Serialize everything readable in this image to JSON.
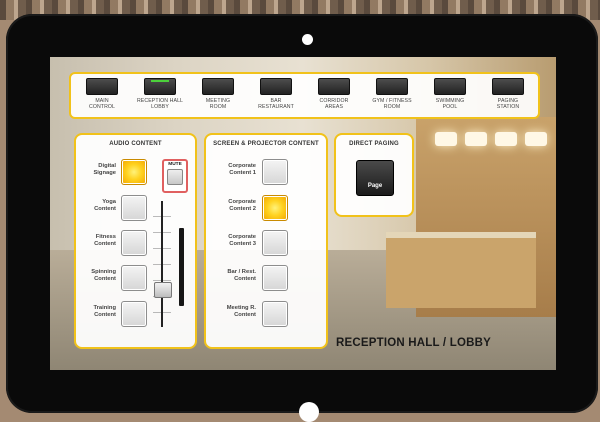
{
  "nav": {
    "items": [
      {
        "label_1": "MAIN",
        "label_2": "CONTROL"
      },
      {
        "label_1": "RECEPTION HALL",
        "label_2": "LOBBY",
        "active": true
      },
      {
        "label_1": "MEETING",
        "label_2": "ROOM"
      },
      {
        "label_1": "BAR",
        "label_2": "RESTAURANT"
      },
      {
        "label_1": "CORRIDOR",
        "label_2": "AREAS"
      },
      {
        "label_1": "GYM / FITNESS",
        "label_2": "ROOM"
      },
      {
        "label_1": "SWIMMING",
        "label_2": "POOL"
      },
      {
        "label_1": "PAGING",
        "label_2": "STATION"
      }
    ]
  },
  "audio": {
    "title": "AUDIO CONTENT",
    "mute_label": "MUTE",
    "volume_level": 0.28,
    "items": [
      {
        "label_1": "Digital",
        "label_2": "Signage",
        "active": true
      },
      {
        "label_1": "Yoga",
        "label_2": "Content",
        "active": false
      },
      {
        "label_1": "Fitness",
        "label_2": "Content",
        "active": false
      },
      {
        "label_1": "Spinning",
        "label_2": "Content",
        "active": false
      },
      {
        "label_1": "Training",
        "label_2": "Content",
        "active": false
      }
    ]
  },
  "screen": {
    "title": "SCREEN & PROJECTOR CONTENT",
    "items": [
      {
        "label_1": "Corporate",
        "label_2": "Content 1",
        "active": false
      },
      {
        "label_1": "Corporate",
        "label_2": "Content 2",
        "active": true
      },
      {
        "label_1": "Corporate",
        "label_2": "Content 3",
        "active": false
      },
      {
        "label_1": "Bar / Rest.",
        "label_2": "Content",
        "active": false
      },
      {
        "label_1": "Meeting R.",
        "label_2": "Content",
        "active": false
      }
    ]
  },
  "paging": {
    "title": "DIRECT PAGING",
    "button_label": "Page"
  },
  "location_title": "RECEPTION HALL / LOBBY",
  "colors": {
    "accent_border": "#f1c21a",
    "active_button": "#ffd21f",
    "mute_border": "#e06060",
    "nav_active_indicator": "#4cd13b"
  }
}
